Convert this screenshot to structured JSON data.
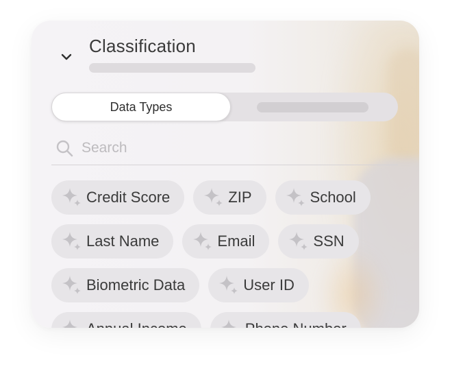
{
  "panel": {
    "title": "Classification",
    "segmented": {
      "active_label": "Data Types"
    },
    "search": {
      "placeholder": "Search",
      "value": ""
    },
    "tags": [
      [
        "Credit Score",
        "ZIP",
        "School"
      ],
      [
        "Last Name",
        "Email",
        "SSN"
      ],
      [
        "Biometric Data",
        "User ID"
      ],
      [
        "Annual Income",
        "Phone Number"
      ]
    ]
  },
  "colors": {
    "card_bg": "#f5f3f6",
    "tag_bg": "#e7e5e8",
    "text": "#3a3a3a",
    "placeholder": "#bdbbbe",
    "icon": "#c4c2c6"
  },
  "icons": {
    "collapse": "chevron-down-icon",
    "search": "search-icon",
    "tag": "sparkle-icon"
  }
}
